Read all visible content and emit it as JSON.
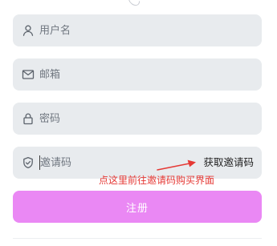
{
  "form": {
    "username": {
      "icon": "user-icon",
      "placeholder": "用户名",
      "value": ""
    },
    "email": {
      "icon": "mail-icon",
      "placeholder": "邮箱",
      "value": ""
    },
    "password": {
      "icon": "lock-icon",
      "placeholder": "密码",
      "value": ""
    },
    "invite_code": {
      "icon": "shield-check-icon",
      "placeholder": "邀请码",
      "value": "",
      "get_code_label": "获取邀请码"
    },
    "submit_label": "注册"
  },
  "annotation": {
    "text": "点这里前往邀请码购买界面",
    "color": "#e53935"
  },
  "colors": {
    "field_background": "#e8ebee",
    "submit_background": "#ea88f4",
    "submit_text": "#ffffff"
  }
}
